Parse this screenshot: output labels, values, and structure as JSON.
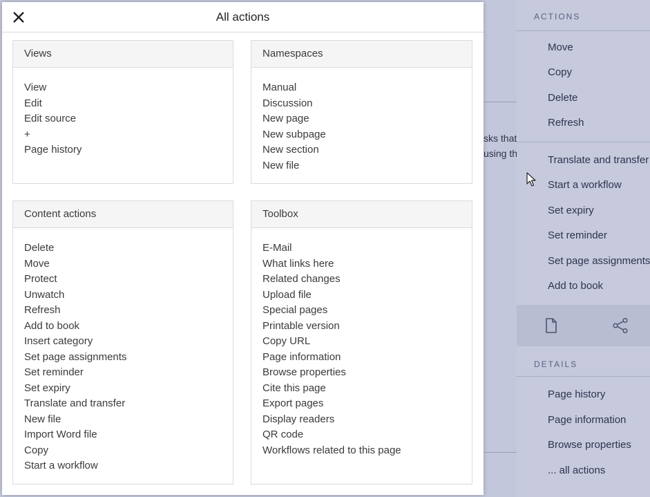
{
  "modal": {
    "title": "All actions",
    "panels": [
      {
        "heading": "Views",
        "items": [
          "View",
          "Edit",
          "Edit source",
          "+",
          "Page history"
        ]
      },
      {
        "heading": "Namespaces",
        "items": [
          "Manual",
          "Discussion",
          "New page",
          "New subpage",
          "New section",
          "New file"
        ]
      },
      {
        "heading": "Content actions",
        "items": [
          "Delete",
          "Move",
          "Protect",
          "Unwatch",
          "Refresh",
          "Add to book",
          "Insert category",
          "Set page assignments",
          "Set reminder",
          "Set expiry",
          "Translate and transfer",
          "New file",
          "Import Word file",
          "Copy",
          "Start a workflow"
        ]
      },
      {
        "heading": "Toolbox",
        "items": [
          "E-Mail",
          "What links here",
          "Related changes",
          "Upload file",
          "Special pages",
          "Printable version",
          "Copy URL",
          "Page information",
          "Browse properties",
          "Cite this page",
          "Export pages",
          "Display readers",
          "QR code",
          "Workflows related to this page"
        ]
      }
    ]
  },
  "background": {
    "text_line1": "sks that",
    "text_line2": "using th"
  },
  "sidebar": {
    "actions_heading": "ACTIONS",
    "group1": [
      "Move",
      "Copy",
      "Delete",
      "Refresh"
    ],
    "group2": [
      "Translate and transfer",
      "Start a workflow",
      "Set expiry",
      "Set reminder",
      "Set page assignments",
      "Add to book"
    ],
    "details_heading": "DETAILS",
    "details": [
      "Page history",
      "Page information",
      "Browse properties",
      "... all actions"
    ],
    "icons": [
      "page-icon",
      "share-icon"
    ]
  },
  "colors": {
    "overlay": "#c3c7db",
    "sidebar": "#c6cadc",
    "modal_bg": "#ffffff",
    "panel_head": "#f5f5f5"
  }
}
